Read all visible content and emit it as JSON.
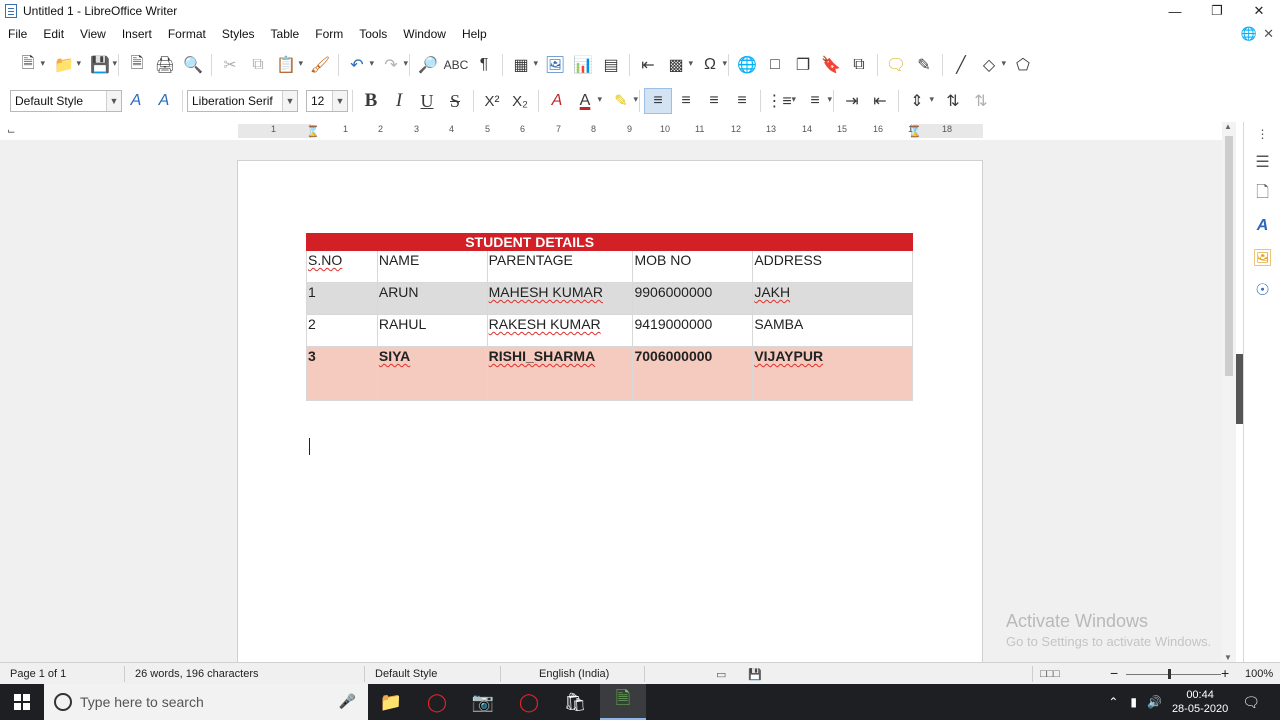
{
  "window": {
    "title": "Untitled 1 - LibreOffice Writer"
  },
  "menu": [
    "File",
    "Edit",
    "View",
    "Insert",
    "Format",
    "Styles",
    "Table",
    "Form",
    "Tools",
    "Window",
    "Help"
  ],
  "format_bar": {
    "paragraph_style": "Default Style",
    "font_name": "Liberation Serif",
    "font_size": "12"
  },
  "ruler": {
    "numbers": [
      "1",
      "1",
      "2",
      "3",
      "4",
      "5",
      "6",
      "7",
      "8",
      "9",
      "10",
      "11",
      "12",
      "13",
      "14",
      "15",
      "16",
      "17",
      "18"
    ]
  },
  "document": {
    "table": {
      "title": "STUDENT DETAILS",
      "columns": [
        "S.NO",
        "NAME",
        "PARENTAGE",
        "MOB NO",
        "ADDRESS"
      ],
      "rows": [
        [
          "1",
          "ARUN",
          "MAHESH KUMAR",
          "9906000000",
          "JAKH"
        ],
        [
          "2",
          "RAHUL",
          "RAKESH KUMAR",
          "9419000000",
          "SAMBA"
        ],
        [
          "3",
          "SIYA",
          "RISHI_SHARMA",
          "7006000000",
          "VIJAYPUR"
        ]
      ]
    }
  },
  "watermark": {
    "line1": "Activate Windows",
    "line2": "Go to Settings to activate Windows."
  },
  "statusbar": {
    "page": "Page 1 of 1",
    "words": "26 words, 196 characters",
    "page_style": "Default Style",
    "language": "English (India)",
    "zoom": "100%"
  },
  "taskbar": {
    "search_placeholder": "Type here to search",
    "time": "00:44",
    "date": "28-05-2020"
  },
  "colors": {
    "table_header": "#d31f26",
    "row_grey": "#dcdcdc",
    "row_highlight": "#f6cbbf"
  }
}
